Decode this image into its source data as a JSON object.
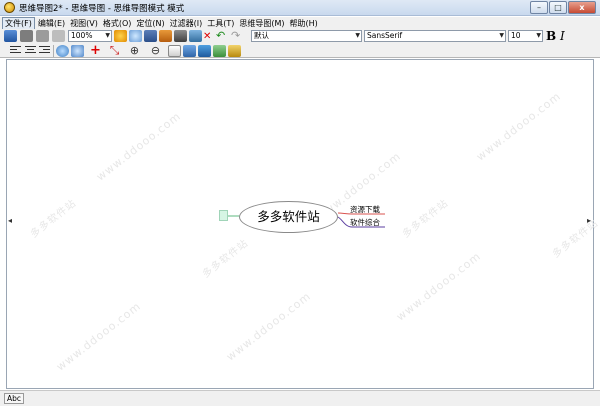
{
  "window": {
    "title": "思维导图2* - 思维导图 - 思维导图模式 模式",
    "buttons": {
      "minimize": "–",
      "maximize": "□",
      "close": "x"
    }
  },
  "menu": [
    "文件(F)",
    "编辑(E)",
    "视图(V)",
    "格式(O)",
    "定位(N)",
    "过滤器(I)",
    "工具(T)",
    "思维导图(M)",
    "帮助(H)"
  ],
  "toolbar": {
    "zoom": "100%",
    "style": "默认",
    "font": "SansSerif",
    "size": "10",
    "bold": "B",
    "italic": "I"
  },
  "mindmap": {
    "root": "多多软件站",
    "children": [
      "资源下载",
      "软件综合"
    ],
    "colors": {
      "child1_edge": "#d9534f",
      "child2_edge": "#5b3fa0",
      "left_stub": "#d6f5e4",
      "root_border": "#8a8a8a"
    }
  },
  "watermark": {
    "site": "www.ddooo.com",
    "cn": "多多软件站"
  },
  "status": {
    "left": "Abc"
  },
  "icons": [
    "app-icon",
    "mode-toggle-icon",
    "back-icon",
    "forward-icon",
    "new-map-icon",
    "open-icon",
    "save-icon",
    "save-as-icon",
    "print-icon",
    "close-map-icon",
    "undo-icon",
    "redo-icon",
    "align-left-icon",
    "align-center-icon",
    "align-right-icon",
    "cloud-icon",
    "edge-color-icon",
    "add-link-icon",
    "remove-link-icon",
    "add-child-icon",
    "remove-child-icon",
    "fold-icon",
    "unfold-icon",
    "export-icon",
    "icon-add-icon"
  ]
}
